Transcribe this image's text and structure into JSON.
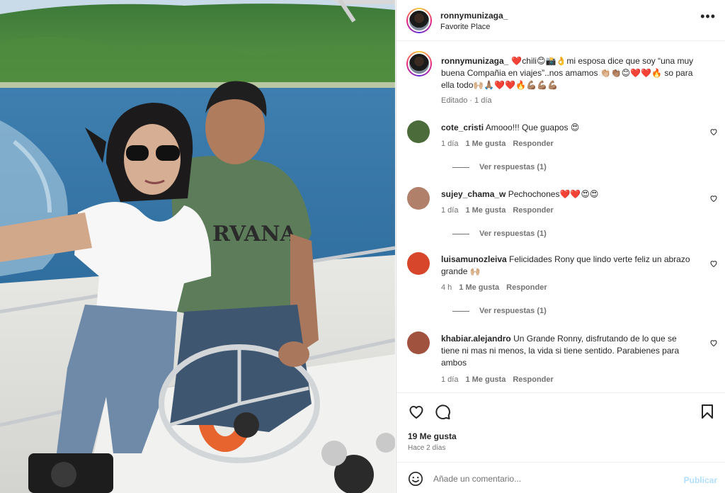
{
  "post": {
    "username": "ronnymunizaga_",
    "location": "Favorite Place",
    "caption_user": "ronnymunizaga_",
    "caption_text": "❤️chili😊📸👌mi esposa dice que soy “una muy buena Compañia en viajes”..nos amamos 👏🏼👏🏽😊❤️❤️🔥 so para ella todo🙌🏼🙏🏽❤️❤️🔥💪🏽💪🏽💪🏽",
    "caption_meta": "Editado · 1 día",
    "likes": "19 Me gusta",
    "posted_ago": "Hace 2 días"
  },
  "comments": [
    {
      "user": "cote_cristi",
      "text": "Amooo!!! Que guapos 😍",
      "time": "1 día",
      "likes": "1 Me gusta",
      "reply": "Responder",
      "view_replies": "Ver respuestas (1)",
      "avatar_color": "#4b6b3a"
    },
    {
      "user": "sujey_chama_w",
      "text": "Pechochones❤️❤️😍😍",
      "time": "1 día",
      "likes": "1 Me gusta",
      "reply": "Responder",
      "view_replies": "Ver respuestas (1)",
      "avatar_color": "#b0806a"
    },
    {
      "user": "luisamunozleiva",
      "text": "Felicidades Rony que lindo verte feliz un abrazo grande 🙌🏼",
      "time": "4 h",
      "likes": "1 Me gusta",
      "reply": "Responder",
      "view_replies": "Ver respuestas (1)",
      "avatar_color": "#d7452b"
    },
    {
      "user": "khabiar.alejandro",
      "text": "Un Grande Ronny, disfrutando de lo que se tiene ni mas ni menos, la vida si tiene sentido. Parabienes para ambos",
      "time": "1 día",
      "likes": "1 Me gusta",
      "reply": "Responder",
      "view_replies": "",
      "avatar_color": "#a0523e"
    }
  ],
  "add_comment": {
    "placeholder": "Añade un comentario...",
    "publish_label": "Publicar"
  },
  "icons": {
    "more": "more-options-icon",
    "like": "heart-icon",
    "comment": "comment-icon",
    "save": "bookmark-icon",
    "emoji": "emoji-icon"
  },
  "colors": {
    "publish_disabled": "#b2dffc",
    "secondary_text": "#737373",
    "primary_text": "#262626"
  }
}
